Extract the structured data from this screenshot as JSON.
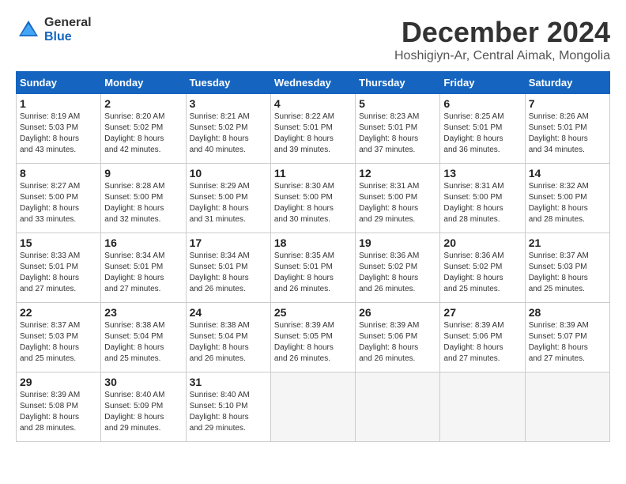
{
  "logo": {
    "general": "General",
    "blue": "Blue"
  },
  "title": "December 2024",
  "subtitle": "Hoshigiyn-Ar, Central Aimak, Mongolia",
  "weekdays": [
    "Sunday",
    "Monday",
    "Tuesday",
    "Wednesday",
    "Thursday",
    "Friday",
    "Saturday"
  ],
  "weeks": [
    [
      {
        "day": "1",
        "sunrise": "8:19 AM",
        "sunset": "5:03 PM",
        "daylight": "8 hours and 43 minutes."
      },
      {
        "day": "2",
        "sunrise": "8:20 AM",
        "sunset": "5:02 PM",
        "daylight": "8 hours and 42 minutes."
      },
      {
        "day": "3",
        "sunrise": "8:21 AM",
        "sunset": "5:02 PM",
        "daylight": "8 hours and 40 minutes."
      },
      {
        "day": "4",
        "sunrise": "8:22 AM",
        "sunset": "5:01 PM",
        "daylight": "8 hours and 39 minutes."
      },
      {
        "day": "5",
        "sunrise": "8:23 AM",
        "sunset": "5:01 PM",
        "daylight": "8 hours and 37 minutes."
      },
      {
        "day": "6",
        "sunrise": "8:25 AM",
        "sunset": "5:01 PM",
        "daylight": "8 hours and 36 minutes."
      },
      {
        "day": "7",
        "sunrise": "8:26 AM",
        "sunset": "5:01 PM",
        "daylight": "8 hours and 34 minutes."
      }
    ],
    [
      {
        "day": "8",
        "sunrise": "8:27 AM",
        "sunset": "5:00 PM",
        "daylight": "8 hours and 33 minutes."
      },
      {
        "day": "9",
        "sunrise": "8:28 AM",
        "sunset": "5:00 PM",
        "daylight": "8 hours and 32 minutes."
      },
      {
        "day": "10",
        "sunrise": "8:29 AM",
        "sunset": "5:00 PM",
        "daylight": "8 hours and 31 minutes."
      },
      {
        "day": "11",
        "sunrise": "8:30 AM",
        "sunset": "5:00 PM",
        "daylight": "8 hours and 30 minutes."
      },
      {
        "day": "12",
        "sunrise": "8:31 AM",
        "sunset": "5:00 PM",
        "daylight": "8 hours and 29 minutes."
      },
      {
        "day": "13",
        "sunrise": "8:31 AM",
        "sunset": "5:00 PM",
        "daylight": "8 hours and 28 minutes."
      },
      {
        "day": "14",
        "sunrise": "8:32 AM",
        "sunset": "5:00 PM",
        "daylight": "8 hours and 28 minutes."
      }
    ],
    [
      {
        "day": "15",
        "sunrise": "8:33 AM",
        "sunset": "5:01 PM",
        "daylight": "8 hours and 27 minutes."
      },
      {
        "day": "16",
        "sunrise": "8:34 AM",
        "sunset": "5:01 PM",
        "daylight": "8 hours and 27 minutes."
      },
      {
        "day": "17",
        "sunrise": "8:34 AM",
        "sunset": "5:01 PM",
        "daylight": "8 hours and 26 minutes."
      },
      {
        "day": "18",
        "sunrise": "8:35 AM",
        "sunset": "5:01 PM",
        "daylight": "8 hours and 26 minutes."
      },
      {
        "day": "19",
        "sunrise": "8:36 AM",
        "sunset": "5:02 PM",
        "daylight": "8 hours and 26 minutes."
      },
      {
        "day": "20",
        "sunrise": "8:36 AM",
        "sunset": "5:02 PM",
        "daylight": "8 hours and 25 minutes."
      },
      {
        "day": "21",
        "sunrise": "8:37 AM",
        "sunset": "5:03 PM",
        "daylight": "8 hours and 25 minutes."
      }
    ],
    [
      {
        "day": "22",
        "sunrise": "8:37 AM",
        "sunset": "5:03 PM",
        "daylight": "8 hours and 25 minutes."
      },
      {
        "day": "23",
        "sunrise": "8:38 AM",
        "sunset": "5:04 PM",
        "daylight": "8 hours and 25 minutes."
      },
      {
        "day": "24",
        "sunrise": "8:38 AM",
        "sunset": "5:04 PM",
        "daylight": "8 hours and 26 minutes."
      },
      {
        "day": "25",
        "sunrise": "8:39 AM",
        "sunset": "5:05 PM",
        "daylight": "8 hours and 26 minutes."
      },
      {
        "day": "26",
        "sunrise": "8:39 AM",
        "sunset": "5:06 PM",
        "daylight": "8 hours and 26 minutes."
      },
      {
        "day": "27",
        "sunrise": "8:39 AM",
        "sunset": "5:06 PM",
        "daylight": "8 hours and 27 minutes."
      },
      {
        "day": "28",
        "sunrise": "8:39 AM",
        "sunset": "5:07 PM",
        "daylight": "8 hours and 27 minutes."
      }
    ],
    [
      {
        "day": "29",
        "sunrise": "8:39 AM",
        "sunset": "5:08 PM",
        "daylight": "8 hours and 28 minutes."
      },
      {
        "day": "30",
        "sunrise": "8:40 AM",
        "sunset": "5:09 PM",
        "daylight": "8 hours and 29 minutes."
      },
      {
        "day": "31",
        "sunrise": "8:40 AM",
        "sunset": "5:10 PM",
        "daylight": "8 hours and 29 minutes."
      },
      null,
      null,
      null,
      null
    ]
  ],
  "labels": {
    "sunrise": "Sunrise:",
    "sunset": "Sunset:",
    "daylight": "Daylight hours"
  }
}
